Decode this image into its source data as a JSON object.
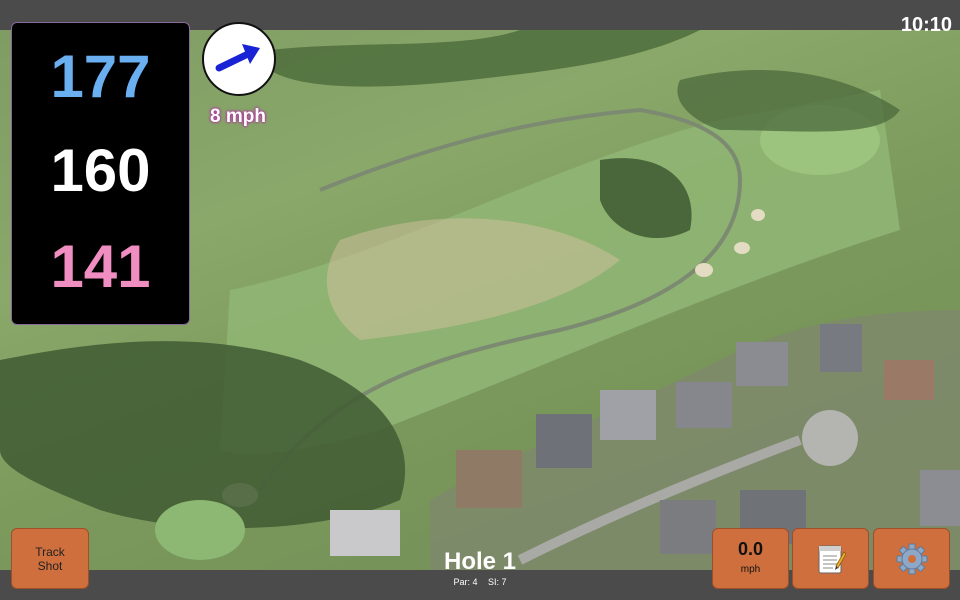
{
  "status_bar": {
    "time": "10:10"
  },
  "distances": {
    "back": "177",
    "middle": "160",
    "front": "141"
  },
  "wind": {
    "speed_label": "8 mph",
    "direction_icon": "wind-arrow-icon"
  },
  "hole": {
    "title": "Hole 1",
    "par_label": "Par: 4",
    "si_label": "SI: 7"
  },
  "buttons": {
    "track_shot_line1": "Track",
    "track_shot_line2": "Shot",
    "speed_value": "0.0",
    "speed_unit": "mph",
    "notes_icon": "notepad-icon",
    "settings_icon": "gear-icon"
  },
  "colors": {
    "back_distance": "#6ab0f0",
    "middle_distance": "#ffffff",
    "front_distance": "#f08ec2",
    "button_orange": "#cf6f3d",
    "wind_text_glow": "#b03aa0"
  }
}
